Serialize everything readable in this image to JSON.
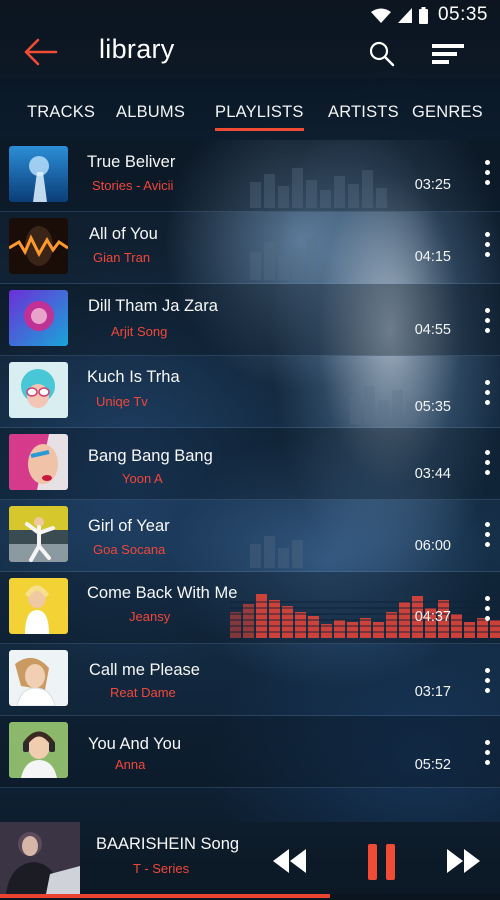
{
  "status_bar": {
    "time": "05:35",
    "icons": [
      "wifi-icon",
      "cell-signal-icon",
      "battery-icon"
    ]
  },
  "header": {
    "title": "library",
    "icons": [
      "back-arrow-icon",
      "search-icon",
      "sort-menu-icon"
    ]
  },
  "tabs": [
    {
      "label": "TRACKS"
    },
    {
      "label": "ALBUMS"
    },
    {
      "label": "PLAYLISTS",
      "active": true
    },
    {
      "label": "ARTISTS"
    },
    {
      "label": "GENRES"
    }
  ],
  "tracks": [
    {
      "title": "True Beliver",
      "artist": "Stories - Avicii",
      "duration": "03:25"
    },
    {
      "title": "All of You",
      "artist": "Gian Tran",
      "duration": "04:15"
    },
    {
      "title": "Dill Tham Ja Zara",
      "artist": "Arjit Song",
      "duration": "04:55"
    },
    {
      "title": "Kuch Is Trha",
      "artist": "Uniqe Tv",
      "duration": "05:35"
    },
    {
      "title": "Bang Bang Bang",
      "artist": "Yoon A",
      "duration": "03:44"
    },
    {
      "title": "Girl  of  Year",
      "artist": "Goa Socana",
      "duration": "06:00"
    },
    {
      "title": "Come Back With  Me",
      "artist": "Jeansy",
      "duration": "04:37",
      "playing": true
    },
    {
      "title": "Call me Please",
      "artist": "Reat Dame",
      "duration": "03:17"
    },
    {
      "title": "You And You",
      "artist": "Anna",
      "duration": "05:52"
    }
  ],
  "player": {
    "song": "BAARISHEIN Song",
    "artist": "T - Series",
    "progress": 0.66,
    "icons": [
      "rewind-icon",
      "pause-icon",
      "fast-forward-icon"
    ]
  },
  "colors": {
    "accent": "#f04b35",
    "artist_text": "#f2473a",
    "background": "#0c1722"
  }
}
